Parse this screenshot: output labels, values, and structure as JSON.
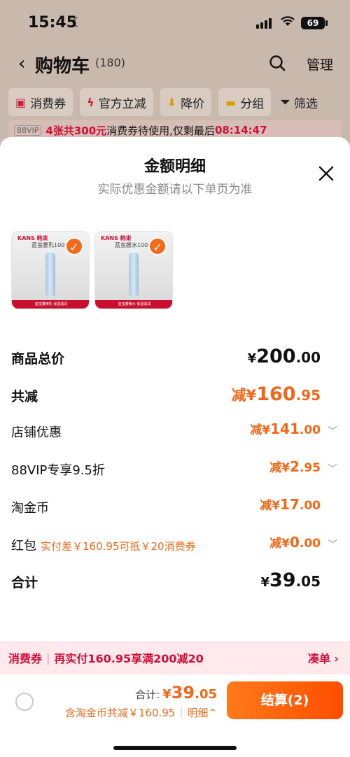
{
  "status_bar": {
    "time": "15:45",
    "battery": "69"
  },
  "nav": {
    "title": "购物车",
    "count": "(180)",
    "manage": "管理"
  },
  "filters": [
    {
      "label": "消费券"
    },
    {
      "label": "官方立减"
    },
    {
      "label": "降价"
    },
    {
      "label": "分组"
    },
    {
      "label": "筛选"
    }
  ],
  "promo": {
    "tag": "88VIP",
    "highlight": "4张共300元",
    "text": "消费券待使用,仅剩最后",
    "timer": "08:14:47"
  },
  "sheet": {
    "title": "金额明细",
    "subtitle": "实际优惠金额请以下单页为准"
  },
  "products": [
    {
      "brand": "KANS 韩束",
      "name": "蓝蛮腰乳100ml",
      "strip": "蓝蛮腰精乳 保湿滋润"
    },
    {
      "brand": "KANS 韩束",
      "name": "蓝蛮腰水100ml",
      "strip": "蓝蛮腰精水 保湿滋润"
    }
  ],
  "rows": {
    "total_price": {
      "label": "商品总价",
      "currency": "¥",
      "int": "200",
      "dec": ".00"
    },
    "total_reduce": {
      "label": "共减",
      "prefix": "减¥",
      "int": "160",
      "dec": ".95"
    },
    "store_discount": {
      "label": "店铺优惠",
      "prefix": "减¥",
      "int": "141",
      "dec": ".00"
    },
    "vip_discount": {
      "label": "88VIP专享9.5折",
      "prefix": "减¥",
      "int": "2",
      "dec": ".95"
    },
    "taojinbi": {
      "label": "淘金币",
      "prefix": "减¥",
      "int": "17",
      "dec": ".00"
    },
    "red_packet": {
      "label": "红包",
      "note": "实付差￥160.95可抵￥20消费券",
      "prefix": "减¥",
      "int": "0",
      "dec": ".00"
    },
    "sum": {
      "label": "合计",
      "currency": "¥",
      "int": "39",
      "dec": ".05"
    }
  },
  "coupon_bar": {
    "label": "消费券",
    "text": "再实付160.95享满200减20",
    "link": "凑单 ›"
  },
  "bottom": {
    "total_label": "合计:",
    "currency": "¥",
    "int": "39",
    "dec": ".05",
    "sub_text": "含淘金币共减￥160.95",
    "detail": "明细⌃",
    "checkout": "结算(2)"
  },
  "colors": {
    "accent": "#f0691b",
    "brand_red": "#d0103a"
  }
}
